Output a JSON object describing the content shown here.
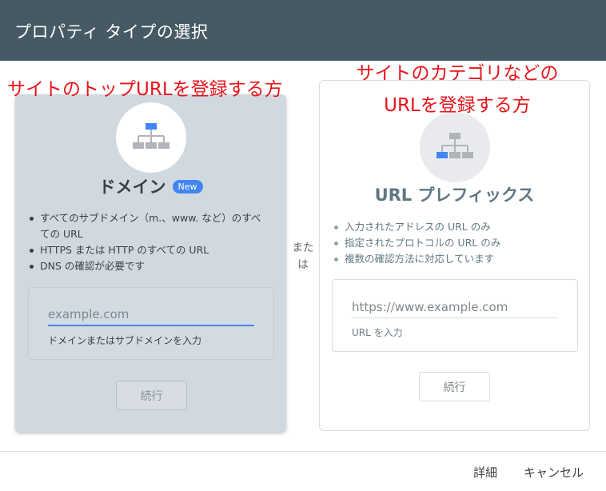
{
  "colors": {
    "header_bg": "#455a64",
    "accent_blue": "#4285f4",
    "annotation_red": "#e8141a",
    "domain_card_bg": "#d1d9e0"
  },
  "header": {
    "title": "プロパティ タイプの選択"
  },
  "annotations": {
    "left": "サイトのトップURLを登録する方",
    "right_line1": "サイトのカテゴリなどの",
    "right_line2": "URLを登録する方"
  },
  "separator": "または",
  "domain_card": {
    "icon": "sitemap-icon",
    "title": "ドメイン",
    "badge": "New",
    "bullets": [
      "すべてのサブドメイン（m.、www. など）のすべての URL",
      "HTTPS または HTTP のすべての URL",
      "DNS の確認が必要です"
    ],
    "input_placeholder": "example.com",
    "input_value": "",
    "hint": "ドメインまたはサブドメインを入力",
    "button": "続行"
  },
  "url_card": {
    "icon": "sitemap-icon",
    "title": "URL プレフィックス",
    "bullets": [
      "入力されたアドレスの URL のみ",
      "指定されたプロトコルの URL のみ",
      "複数の確認方法に対応しています"
    ],
    "input_placeholder": "https://www.example.com",
    "input_value": "",
    "hint": "URL を入力",
    "button": "続行"
  },
  "footer": {
    "details": "詳細",
    "cancel": "キャンセル"
  }
}
